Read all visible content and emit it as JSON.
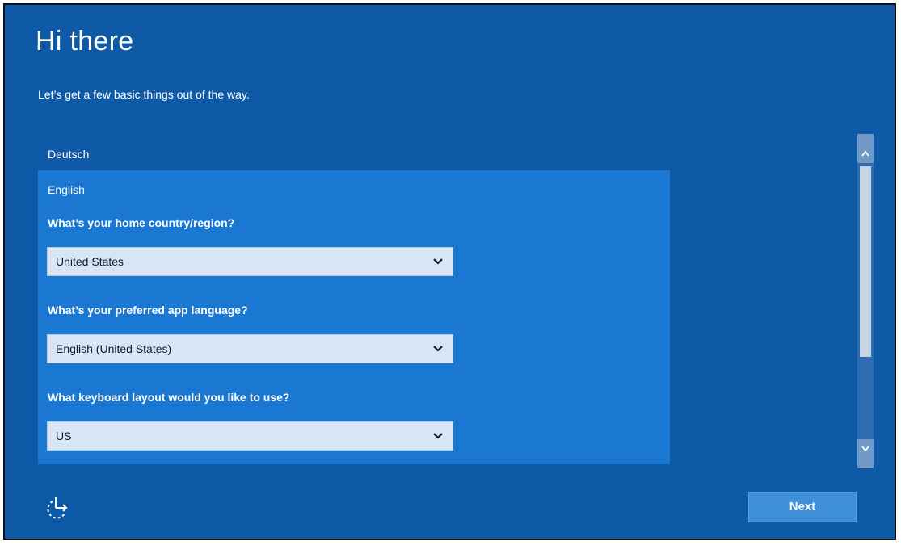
{
  "header": {
    "title": "Hi there",
    "subtitle": "Let’s get a few basic things out of the way."
  },
  "languages": {
    "items": [
      "Deutsch",
      "English"
    ],
    "selected": "English"
  },
  "form": {
    "country_question": "What’s your home country/region?",
    "country_value": "United States",
    "app_language_question": "What’s your preferred app language?",
    "app_language_value": "English (United States)",
    "keyboard_question": "What keyboard layout would you like to use?",
    "keyboard_value": "US"
  },
  "footer": {
    "next_label": "Next",
    "ease_of_access_icon": "ease-of-access-icon"
  },
  "colors": {
    "background": "#0f5aa6",
    "selected_panel": "#1b78d2",
    "dropdown_fill": "#d6e6f5",
    "next_button": "#3e8ed9"
  }
}
